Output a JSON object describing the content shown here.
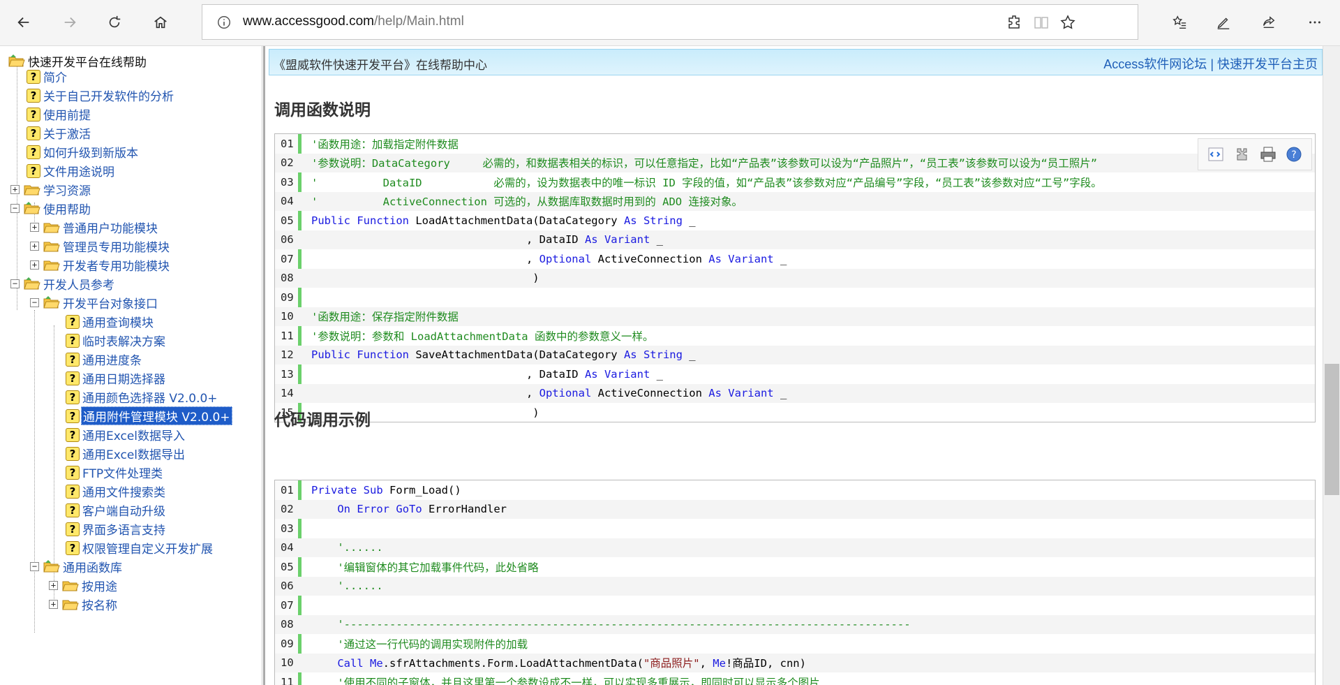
{
  "browser": {
    "url_host": "www.accessgood.com",
    "url_path": "/help/Main.html",
    "icons": [
      "back-icon",
      "forward-icon",
      "refresh-icon",
      "home-icon",
      "info-icon",
      "extension-icon",
      "reading-view-icon",
      "favorite-star-icon",
      "favorites-list-icon",
      "pen-icon",
      "share-icon",
      "more-icon"
    ]
  },
  "tree": {
    "root": "快速开发平台在线帮助",
    "items": [
      {
        "label": "简介"
      },
      {
        "label": "关于自己开发软件的分析"
      },
      {
        "label": "使用前提"
      },
      {
        "label": "关于激活"
      },
      {
        "label": "如何升级到新版本"
      },
      {
        "label": "文件用途说明"
      },
      {
        "label": "学习资源"
      },
      {
        "label": "使用帮助"
      },
      {
        "label": "普通用户功能模块"
      },
      {
        "label": "管理员专用功能模块"
      },
      {
        "label": "开发者专用功能模块"
      },
      {
        "label": "开发人员参考"
      },
      {
        "label": "开发平台对象接口"
      },
      {
        "label": "通用查询模块"
      },
      {
        "label": "临时表解决方案"
      },
      {
        "label": "通用进度条"
      },
      {
        "label": "通用日期选择器"
      },
      {
        "label": "通用颜色选择器 V2.0.0+"
      },
      {
        "label": "通用附件管理模块 V2.0.0+"
      },
      {
        "label": "通用Excel数据导入"
      },
      {
        "label": "通用Excel数据导出"
      },
      {
        "label": "FTP文件处理类"
      },
      {
        "label": "通用文件搜索类"
      },
      {
        "label": "客户端自动升级"
      },
      {
        "label": "界面多语言支持"
      },
      {
        "label": "权限管理自定义开发扩展"
      },
      {
        "label": "通用函数库"
      },
      {
        "label": "按用途"
      },
      {
        "label": "按名称"
      }
    ]
  },
  "banner": {
    "left": "《盟威软件快速开发平台》在线帮助中心",
    "link1": "Access软件网论坛",
    "sep": " | ",
    "link2": "快速开发平台主页"
  },
  "sections": {
    "s1_title": "调用函数说明",
    "s2_title": "代码调用示例"
  },
  "code1": [
    {
      "n": "01",
      "t": "'函数用途：加载指定附件数据"
    },
    {
      "n": "02",
      "t": "'参数说明：DataCategory     必需的，和数据表相关的标识，可以任意指定，比如“产品表”该参数可以设为“产品照片”，“员工表”该参数可以设为“员工照片”"
    },
    {
      "n": "03",
      "t": "'          DataID           必需的，设为数据表中的唯一标识 ID 字段的值，如“产品表”该参数对应“产品编号”字段，“员工表”该参数对应“工号”字段。"
    },
    {
      "n": "04",
      "t": "'          ActiveConnection 可选的，从数据库取数据时用到的 ADO 连接对象。"
    },
    {
      "n": "05",
      "t": "Public Function LoadAttachmentData(DataCategory As String _"
    },
    {
      "n": "06",
      "t": "                                 , DataID As Variant _"
    },
    {
      "n": "07",
      "t": "                                 , Optional ActiveConnection As Variant _"
    },
    {
      "n": "08",
      "t": "                                  )"
    },
    {
      "n": "09",
      "t": ""
    },
    {
      "n": "10",
      "t": "'函数用途：保存指定附件数据"
    },
    {
      "n": "11",
      "t": "'参数说明：参数和 LoadAttachmentData 函数中的参数意义一样。"
    },
    {
      "n": "12",
      "t": "Public Function SaveAttachmentData(DataCategory As String _"
    },
    {
      "n": "13",
      "t": "                                 , DataID As Variant _"
    },
    {
      "n": "14",
      "t": "                                 , Optional ActiveConnection As Variant _"
    },
    {
      "n": "15",
      "t": "                                  )"
    }
  ],
  "code2": [
    {
      "n": "01",
      "t": "Private Sub Form_Load()"
    },
    {
      "n": "02",
      "t": "    On Error GoTo ErrorHandler"
    },
    {
      "n": "03",
      "t": ""
    },
    {
      "n": "04",
      "t": "    '......"
    },
    {
      "n": "05",
      "t": "    '编辑窗体的其它加载事件代码，此处省略"
    },
    {
      "n": "06",
      "t": "    '......"
    },
    {
      "n": "07",
      "t": ""
    },
    {
      "n": "08",
      "t": "    '---------------------------------------------------------------------------------------"
    },
    {
      "n": "09",
      "t": "    '通过这一行代码的调用实现附件的加载"
    },
    {
      "n": "10",
      "t": "    Call Me.sfrAttachments.Form.LoadAttachmentData(\"商品照片\", Me!商品ID, cnn)"
    },
    {
      "n": "11",
      "t": "    '使用不同的子窗体，并且这里第一个参数设成不一样，可以实现多重展示，即同时可以显示多个图片"
    }
  ],
  "toolbox": {
    "icons": [
      "view-source-icon",
      "copy-puzzle-icon",
      "print-icon",
      "help-circle-icon"
    ]
  }
}
